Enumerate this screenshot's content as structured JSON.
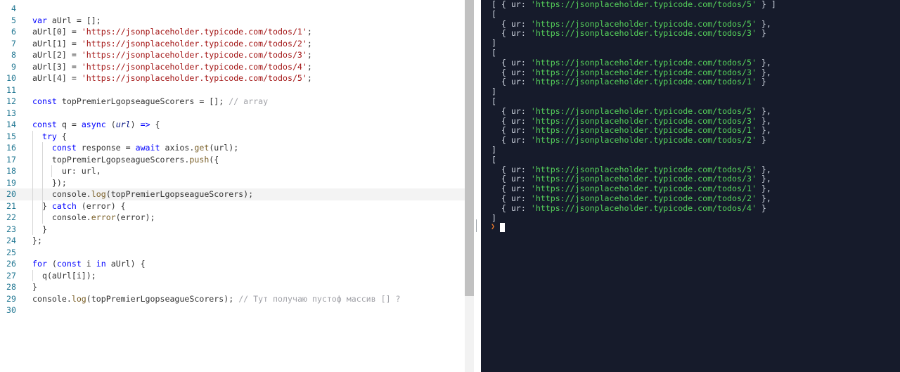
{
  "editor": {
    "lines": [
      {
        "n": "4",
        "code": ""
      },
      {
        "n": "5",
        "code": "var aUrl = [];"
      },
      {
        "n": "6",
        "code": "aUrl[0] = 'https://jsonplaceholder.typicode.com/todos/1';"
      },
      {
        "n": "7",
        "code": "aUrl[1] = 'https://jsonplaceholder.typicode.com/todos/2';"
      },
      {
        "n": "8",
        "code": "aUrl[2] = 'https://jsonplaceholder.typicode.com/todos/3';"
      },
      {
        "n": "9",
        "code": "aUrl[3] = 'https://jsonplaceholder.typicode.com/todos/4';"
      },
      {
        "n": "10",
        "code": "aUrl[4] = 'https://jsonplaceholder.typicode.com/todos/5';"
      },
      {
        "n": "11",
        "code": ""
      },
      {
        "n": "12",
        "code": "const topPremierLgopseagueScorers = []; // array"
      },
      {
        "n": "13",
        "code": ""
      },
      {
        "n": "14",
        "code": "const q = async (url) => {"
      },
      {
        "n": "15",
        "code": "  try {"
      },
      {
        "n": "16",
        "code": "    const response = await axios.get(url);"
      },
      {
        "n": "17",
        "code": "    topPremierLgopseagueScorers.push({"
      },
      {
        "n": "18",
        "code": "      ur: url,"
      },
      {
        "n": "19",
        "code": "    });"
      },
      {
        "n": "20",
        "code": "    console.log(topPremierLgopseagueScorers);"
      },
      {
        "n": "21",
        "code": "  } catch (error) {"
      },
      {
        "n": "22",
        "code": "    console.error(error);"
      },
      {
        "n": "23",
        "code": "  }"
      },
      {
        "n": "24",
        "code": "};"
      },
      {
        "n": "25",
        "code": ""
      },
      {
        "n": "26",
        "code": "for (const i in aUrl) {"
      },
      {
        "n": "27",
        "code": "  q(aUrl[i]);"
      },
      {
        "n": "28",
        "code": "}"
      },
      {
        "n": "29",
        "code": "console.log(topPremierLgopseagueScorers); // Тут получаю пустоф массив [] ?"
      },
      {
        "n": "30",
        "code": ""
      }
    ],
    "active_line": "20"
  },
  "console": {
    "lines": [
      "[ { ur: 'https://jsonplaceholder.typicode.com/todos/5' } ]",
      "[",
      "  { ur: 'https://jsonplaceholder.typicode.com/todos/5' },",
      "  { ur: 'https://jsonplaceholder.typicode.com/todos/3' }",
      "]",
      "[",
      "  { ur: 'https://jsonplaceholder.typicode.com/todos/5' },",
      "  { ur: 'https://jsonplaceholder.typicode.com/todos/3' },",
      "  { ur: 'https://jsonplaceholder.typicode.com/todos/1' }",
      "]",
      "[",
      "  { ur: 'https://jsonplaceholder.typicode.com/todos/5' },",
      "  { ur: 'https://jsonplaceholder.typicode.com/todos/3' },",
      "  { ur: 'https://jsonplaceholder.typicode.com/todos/1' },",
      "  { ur: 'https://jsonplaceholder.typicode.com/todos/2' }",
      "]",
      "[",
      "  { ur: 'https://jsonplaceholder.typicode.com/todos/5' },",
      "  { ur: 'https://jsonplaceholder.typicode.com/todos/3' },",
      "  { ur: 'https://jsonplaceholder.typicode.com/todos/1' },",
      "  { ur: 'https://jsonplaceholder.typicode.com/todos/2' },",
      "  { ur: 'https://jsonplaceholder.typicode.com/todos/4' }",
      "]"
    ],
    "prompt_icon": "chevron-right-icon"
  },
  "colors": {
    "console_bg": "#161b2b",
    "string_green": "#56d15b",
    "prompt_orange": "#f07b2a",
    "line_number": "#237893",
    "keyword_blue": "#0000ff",
    "string_red": "#a31515"
  }
}
